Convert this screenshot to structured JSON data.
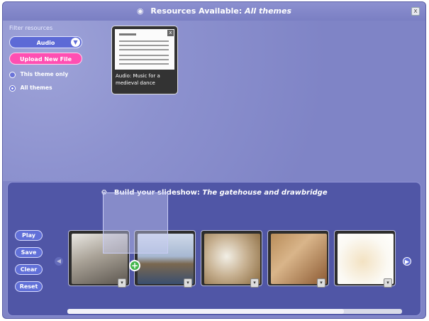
{
  "header": {
    "title_prefix": "Resources Available:",
    "title_theme": "All themes",
    "close_label": "x"
  },
  "filter": {
    "label": "Filter resources",
    "selected_type": "Audio",
    "upload_label": "Upload New File",
    "radio_options": [
      {
        "label": "This theme only",
        "selected": false
      },
      {
        "label": "All themes",
        "selected": true
      }
    ]
  },
  "resources": [
    {
      "caption": "Audio: Music for a medieval dance",
      "remove_label": "x"
    }
  ],
  "slideshow": {
    "title_prefix": "Build your slideshow:",
    "title_name": "The gatehouse and drawbridge",
    "controls": [
      "Play",
      "Save",
      "Clear",
      "Reset"
    ],
    "slides": [
      {
        "subject": "gatehouse-photo"
      },
      {
        "subject": "castle-photo"
      },
      {
        "subject": "model-plans"
      },
      {
        "subject": "cardboard-model"
      },
      {
        "subject": "finished-model"
      }
    ]
  },
  "colors": {
    "background": "#7f84c6",
    "panel": "#5056a6",
    "accent_blue": "#5d6ad6",
    "accent_pink": "#ff4fb2",
    "add_green": "#43b54a"
  }
}
